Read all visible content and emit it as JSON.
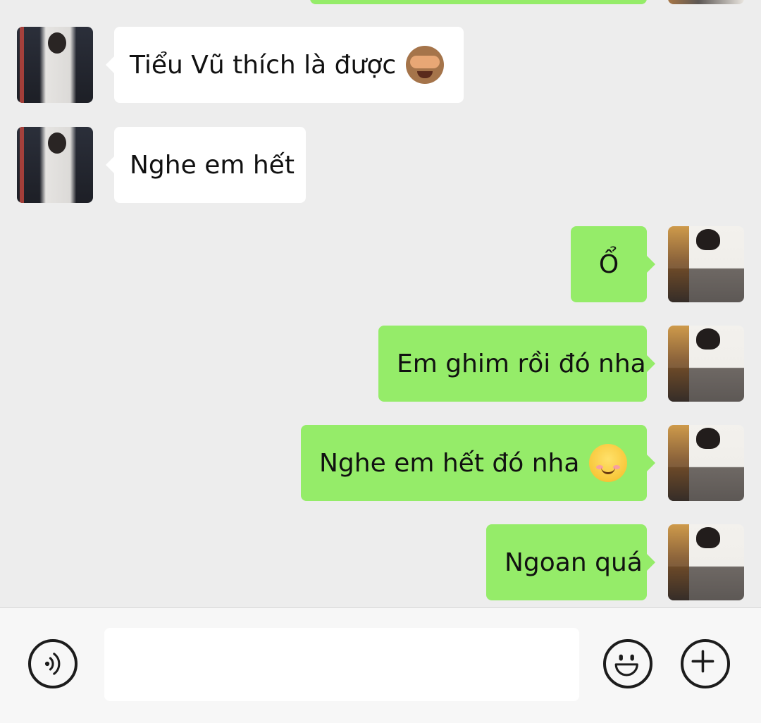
{
  "messages": [
    {
      "sender": "other",
      "text": "Tiểu Vũ thích là được",
      "emoji": "see-no-evil-monkey-emoji"
    },
    {
      "sender": "other",
      "text": "Nghe em hết"
    },
    {
      "sender": "me",
      "text": "Ổ"
    },
    {
      "sender": "me",
      "text": "Em ghim rồi đó nha"
    },
    {
      "sender": "me",
      "text": "Nghe em hết đó nha",
      "emoji": "blushing-smile-emoji"
    },
    {
      "sender": "me",
      "text": "Ngoan quá"
    }
  ],
  "input_bar": {
    "message_value": "",
    "voice_icon": "voice-icon",
    "emoji_icon": "emoji-icon",
    "plus_icon": "plus-icon"
  },
  "colors": {
    "background": "#ededed",
    "my_bubble": "#95ec69",
    "other_bubble": "#ffffff",
    "input_bar": "#f7f7f7"
  }
}
